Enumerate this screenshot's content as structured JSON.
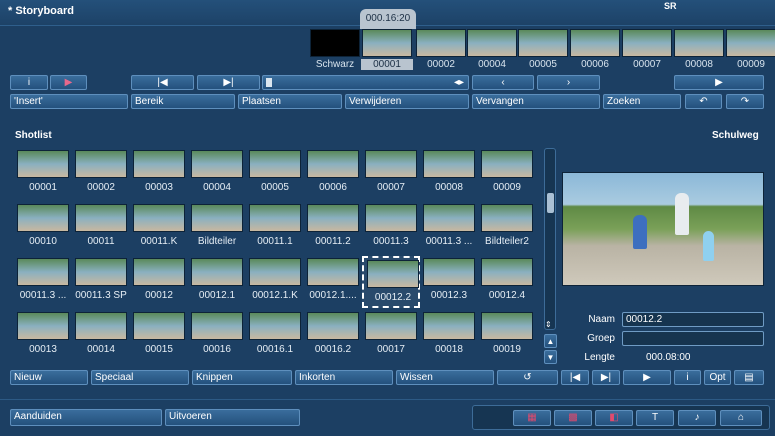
{
  "app": {
    "title": "* Storyboard",
    "sr_label": "SR"
  },
  "timeline": {
    "timecode": "000.16:20",
    "frames": [
      {
        "label": "Schwarz",
        "selected": false
      },
      {
        "label": "00001",
        "selected": true
      },
      {
        "label": "00002",
        "selected": false
      },
      {
        "label": "00004",
        "selected": false
      },
      {
        "label": "00005",
        "selected": false
      },
      {
        "label": "00006",
        "selected": false
      },
      {
        "label": "00007",
        "selected": false
      },
      {
        "label": "00008",
        "selected": false
      },
      {
        "label": "00009",
        "selected": false
      }
    ]
  },
  "toolbar": {
    "info": "i",
    "insert": "'Insert'",
    "range": "Bereik",
    "place": "Plaatsen",
    "delete": "Verwijderen",
    "replace": "Vervangen",
    "search": "Zoeken"
  },
  "shotlist": {
    "title": "Shotlist",
    "album": "Schulweg",
    "items": [
      [
        "00001",
        "00002",
        "00003",
        "00004",
        "00005",
        "00006",
        "00007",
        "00008",
        "00009"
      ],
      [
        "00010",
        "00011",
        "00011.K",
        "Bildteiler",
        "00011.1",
        "00011.2",
        "00011.3",
        "00011.3 ...",
        "Bildteiler2"
      ],
      [
        "00011.3 ...",
        "00011.3 SP",
        "00012",
        "00012.1",
        "00012.1.K",
        "00012.1....",
        "00012.2",
        "00012.3",
        "00012.4"
      ],
      [
        "00013",
        "00014",
        "00015",
        "00016",
        "00016.1",
        "00016.2",
        "00017",
        "00018",
        "00019"
      ]
    ],
    "selected": "00012.2"
  },
  "details": {
    "name_label": "Naam",
    "name_value": "00012.2",
    "group_label": "Groep",
    "group_value": "",
    "length_label": "Lengte",
    "length_value": "000.08:00"
  },
  "actions": {
    "new": "Nieuw",
    "special": "Speciaal",
    "cut": "Knippen",
    "trim": "Inkorten",
    "clear": "Wissen",
    "info": "i",
    "opt": "Opt"
  },
  "footer": {
    "mark": "Aanduiden",
    "execute": "Uitvoeren"
  }
}
